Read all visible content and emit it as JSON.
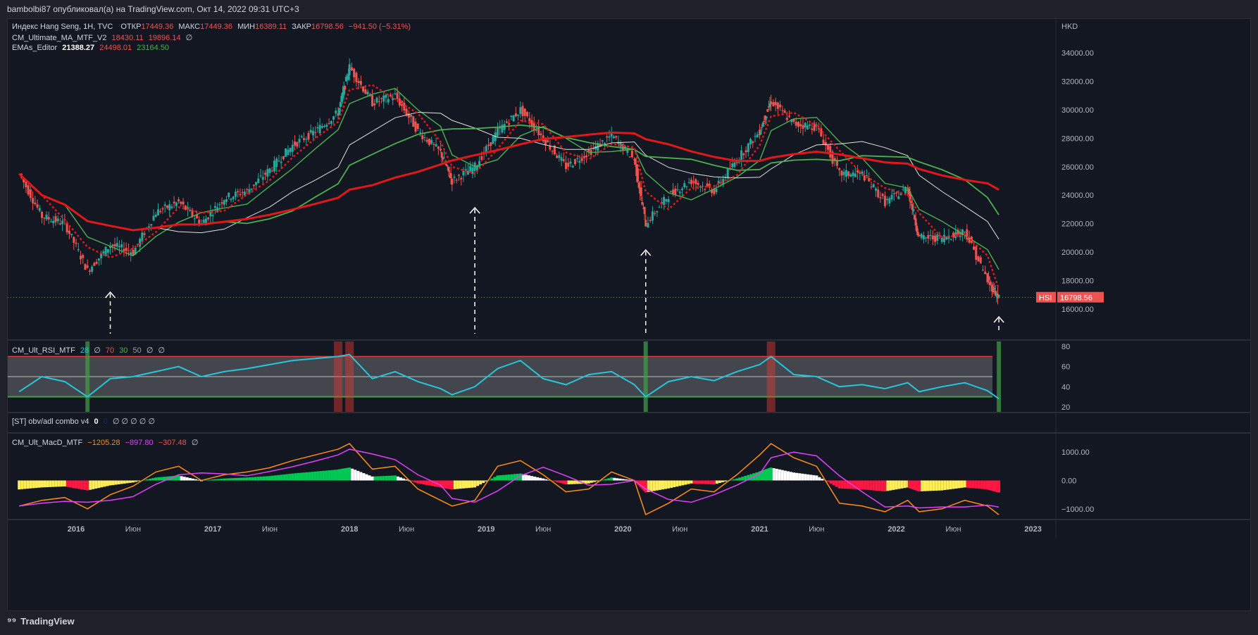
{
  "header": {
    "publisher": "bambolbi87 опубликовал(а) на TradingView.com, Окт 14, 2022 09:31 UTC+3"
  },
  "legend": {
    "main": {
      "symbol": "Индекс Hang Seng, 1Н, TVC",
      "o_label": "ОТКР",
      "o": "17449.36",
      "h_label": "МАКС",
      "h": "17449.36",
      "l_label": "МИН",
      "l": "16389.11",
      "c_label": "ЗАКР",
      "c": "16798.56",
      "chg": "−941.50 (−5.31%)"
    },
    "cm_ma": {
      "name": "CM_Ultimate_MA_MTF_V2",
      "v1": "18430.11",
      "v2": "19896.14",
      "v3": "∅"
    },
    "emas": {
      "name": "EMAs_Editor",
      "v1": "21388.27",
      "v2": "24498.01",
      "v3": "23164.50"
    },
    "rsi": {
      "name": "CM_Ult_RSI_MTF",
      "v1": "28",
      "v2": "∅",
      "v3": "70",
      "v4": "30",
      "v5": "50",
      "v6": "∅",
      "v7": "∅"
    },
    "obv": {
      "name": "[ST] obv/adl combo v4",
      "v1": "0",
      "v2": "0",
      "rest": "∅ ∅ ∅ ∅ ∅"
    },
    "macd": {
      "name": "CM_Ult_MacD_MTF",
      "v1": "−1205.28",
      "v2": "−897.80",
      "v3": "−307.48",
      "v4": "∅"
    }
  },
  "price_axis": {
    "currency": "HKD",
    "ticks": [
      "34000.00",
      "32000.00",
      "30000.00",
      "28000.00",
      "26000.00",
      "24000.00",
      "22000.00",
      "20000.00",
      "18000.00",
      "16000.00"
    ],
    "last_symbol": "HSI",
    "last_price": "16798.56"
  },
  "rsi_axis": {
    "ticks": [
      "80",
      "60",
      "40",
      "20"
    ]
  },
  "macd_axis": {
    "ticks": [
      "1000.00",
      "0.00",
      "−1000.00"
    ]
  },
  "time_axis": {
    "ticks": [
      "2016",
      "Июн",
      "2017",
      "Июн",
      "2018",
      "Июн",
      "2019",
      "Июн",
      "2020",
      "Июн",
      "2021",
      "Июн",
      "2022",
      "Июн",
      "2023"
    ]
  },
  "footer": {
    "brand": "TradingView"
  },
  "colors": {
    "up": "#26a69a",
    "down": "#ef5350",
    "ma_red": "#e01818",
    "ma_green": "#4caf50",
    "ema_white": "#e0e0e0",
    "rsi_line": "#26c6da",
    "macd_orange": "#ff8c1a",
    "macd_signal": "#e040fb"
  },
  "chart_data": {
    "type": "line",
    "title": "",
    "x": [
      "2015-08",
      "2015-10",
      "2015-12",
      "2016-02",
      "2016-04",
      "2016-06",
      "2016-08",
      "2016-10",
      "2016-12",
      "2017-02",
      "2017-04",
      "2017-06",
      "2017-08",
      "2017-10",
      "2017-12",
      "2018-01",
      "2018-03",
      "2018-05",
      "2018-07",
      "2018-09",
      "2018-10",
      "2018-12",
      "2019-02",
      "2019-04",
      "2019-06",
      "2019-08",
      "2019-10",
      "2019-12",
      "2020-02",
      "2020-03",
      "2020-05",
      "2020-07",
      "2020-09",
      "2020-11",
      "2021-01",
      "2021-02",
      "2021-04",
      "2021-06",
      "2021-08",
      "2021-10",
      "2021-12",
      "2022-02",
      "2022-03",
      "2022-05",
      "2022-07",
      "2022-09",
      "2022-10"
    ],
    "series": [
      {
        "name": "HSI",
        "values": [
          25500,
          22500,
          22000,
          18700,
          20500,
          20000,
          22800,
          23500,
          22000,
          23800,
          24300,
          25800,
          27500,
          28500,
          29800,
          33000,
          30500,
          31000,
          28500,
          27000,
          25000,
          26000,
          28500,
          30000,
          28000,
          26000,
          27000,
          28200,
          26500,
          22000,
          24000,
          25000,
          24300,
          26500,
          28500,
          30600,
          29000,
          28800,
          25500,
          25500,
          23500,
          24500,
          21000,
          21000,
          21500,
          18000,
          16800
        ]
      }
    ],
    "ylim": [
      15000,
      35000
    ],
    "rsi": {
      "values": [
        35,
        50,
        45,
        30,
        48,
        50,
        55,
        60,
        50,
        55,
        58,
        62,
        66,
        68,
        70,
        72,
        48,
        55,
        45,
        38,
        32,
        40,
        58,
        66,
        48,
        42,
        52,
        55,
        42,
        30,
        45,
        50,
        46,
        55,
        62,
        70,
        52,
        50,
        40,
        42,
        38,
        44,
        35,
        40,
        44,
        36,
        28
      ],
      "upper": 70,
      "middle": 50,
      "lower": 30,
      "ylim": [
        15,
        85
      ]
    },
    "macd": {
      "macd": [
        -900,
        -700,
        -600,
        -1000,
        -500,
        -200,
        300,
        500,
        0,
        200,
        300,
        450,
        700,
        900,
        1100,
        1300,
        400,
        500,
        -300,
        -700,
        -900,
        -700,
        500,
        700,
        200,
        -400,
        -300,
        300,
        0,
        -1200,
        -800,
        -300,
        -400,
        200,
        900,
        1300,
        800,
        500,
        -800,
        -900,
        -1100,
        -700,
        -1100,
        -1000,
        -700,
        -900,
        -1205
      ]
    },
    "time_axis": {
      "start": "2015-07",
      "end": "2023-03"
    }
  }
}
